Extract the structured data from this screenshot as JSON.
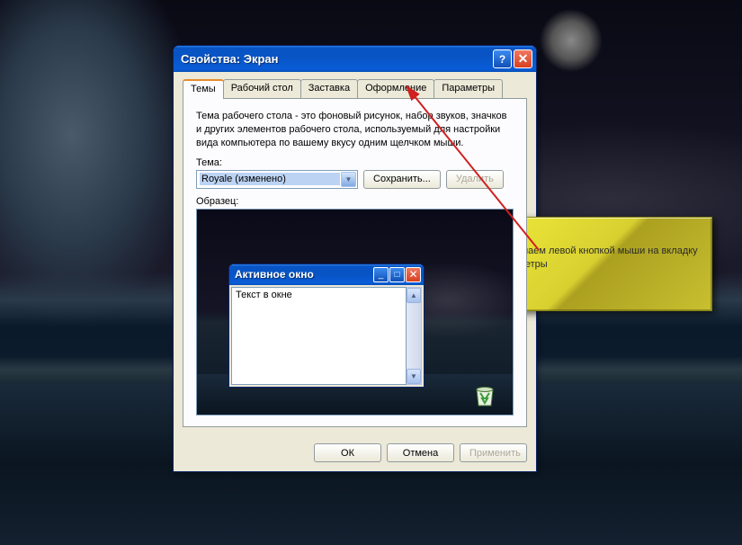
{
  "dialog": {
    "title": "Свойства: Экран",
    "tabs": [
      "Темы",
      "Рабочий стол",
      "Заставка",
      "Оформление",
      "Параметры"
    ],
    "active_tab": 0,
    "description": "Тема рабочего стола - это фоновый рисунок, набор звуков, значков и других элементов рабочего стола, используемый для настройки вида компьютера по вашему вкусу одним щелчком мыши.",
    "theme_label": "Тема:",
    "theme_selected": "Royale (изменено)",
    "save_button": "Сохранить...",
    "delete_button": "Удалить",
    "sample_label": "Образец:",
    "inner_window": {
      "title": "Активное окно",
      "text": "Текст в окне"
    },
    "ok_button": "ОК",
    "cancel_button": "Отмена",
    "apply_button": "Применить"
  },
  "callout": {
    "text": "Нажимаем левой кнопкой мыши на вкладку параметры"
  }
}
